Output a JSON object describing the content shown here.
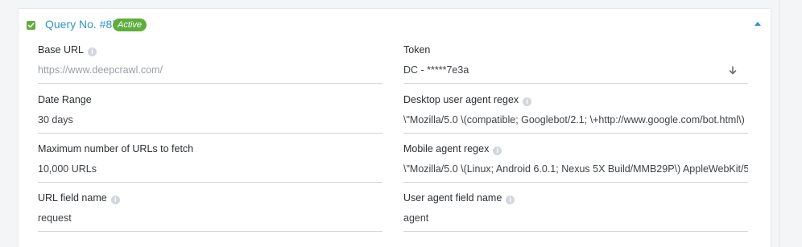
{
  "query": {
    "title": "Query No. #87",
    "status": "Active",
    "collapse_icon": "caret-up-icon",
    "accent_color": "#2f95c8",
    "status_color": "#5fae3c"
  },
  "fields": {
    "base_url": {
      "label": "Base URL",
      "placeholder": "https://www.deepcrawl.com/"
    },
    "token": {
      "label": "Token",
      "value": "DC - *****7e3a",
      "icon": "arrow-down-icon"
    },
    "date_range": {
      "label": "Date Range",
      "value": "30 days"
    },
    "desktop_regex": {
      "label": "Desktop user agent regex",
      "value": "\\\"Mozilla/5.0 \\(compatible; Googlebot/2.1; \\+http://www.google.com/bot.html\\)"
    },
    "max_urls": {
      "label": "Maximum number of URLs to fetch",
      "value": "10,000 URLs"
    },
    "mobile_regex": {
      "label": "Mobile agent regex",
      "value": "\\\"Mozilla/5.0 \\(Linux; Android 6.0.1; Nexus 5X Build/MMB29P\\) AppleWebKit/5"
    },
    "url_field": {
      "label": "URL field name",
      "value": "request"
    },
    "ua_field": {
      "label": "User agent field name",
      "value": "agent"
    }
  },
  "info_glyph": "i"
}
